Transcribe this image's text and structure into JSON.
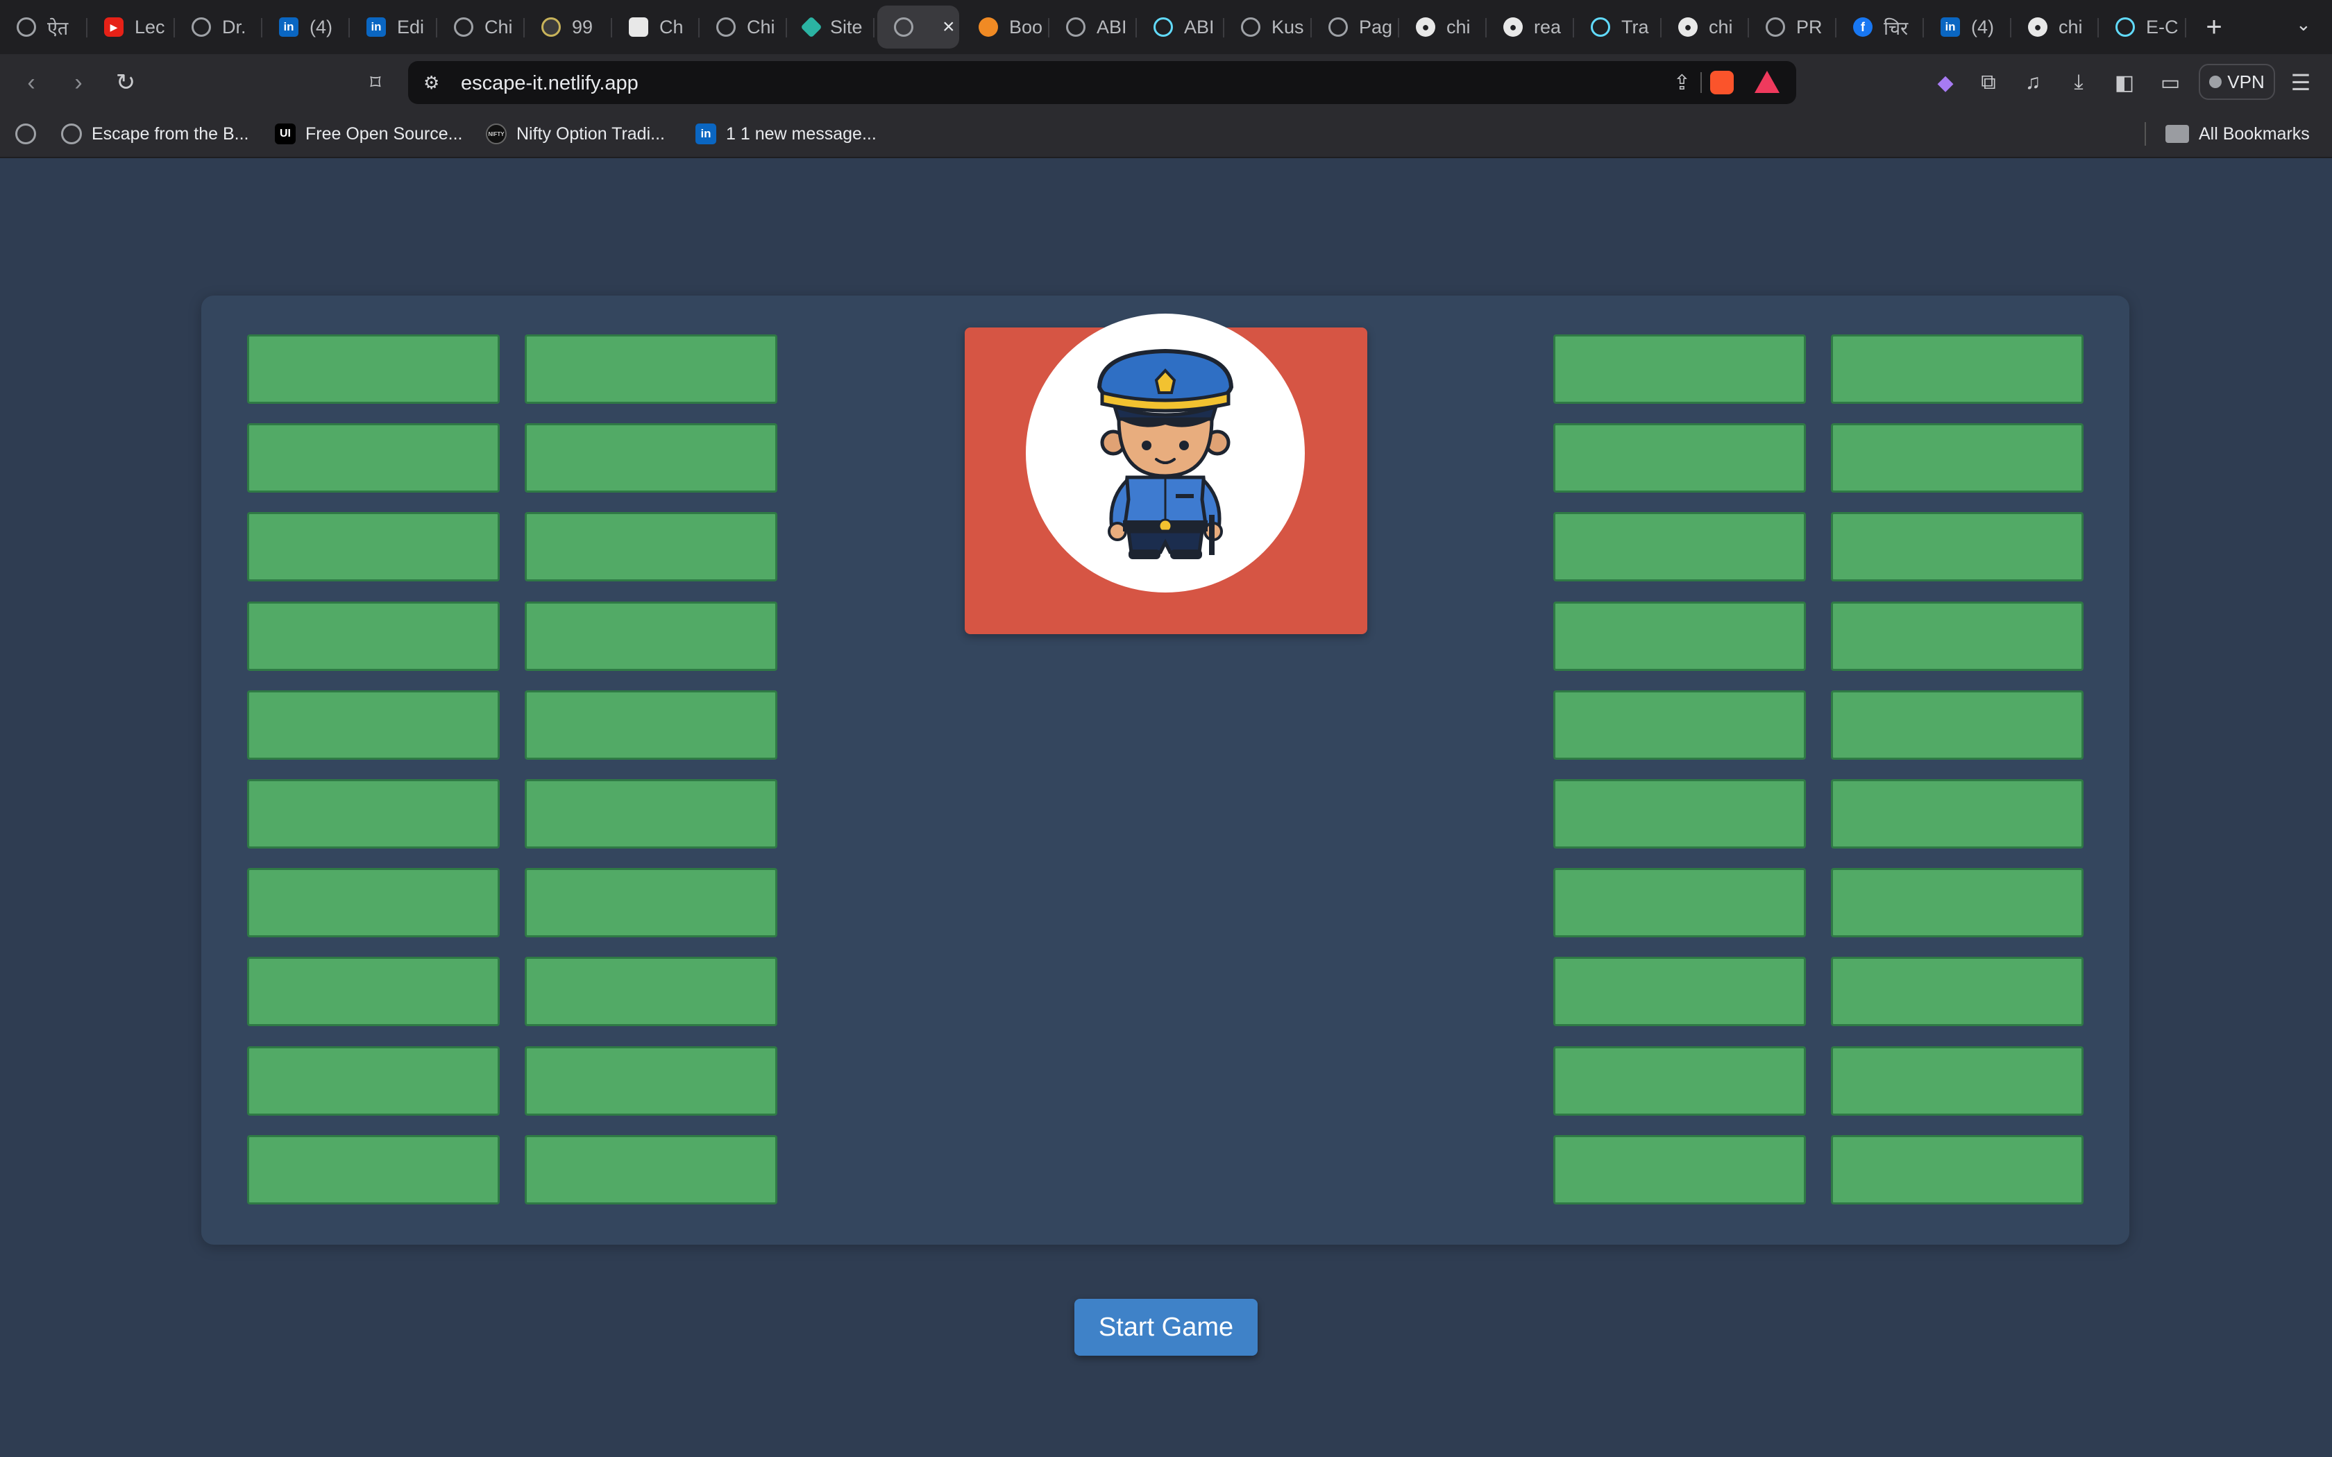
{
  "browser": {
    "tabs": [
      {
        "label": "ऐत",
        "icon": "globe-icon"
      },
      {
        "label": "Lec",
        "icon": "youtube-icon"
      },
      {
        "label": "Dr.",
        "icon": "globe-icon"
      },
      {
        "label": "(4)",
        "icon": "linkedin-icon"
      },
      {
        "label": "Edi",
        "icon": "linkedin-icon"
      },
      {
        "label": "Chi",
        "icon": "globe-icon"
      },
      {
        "label": "99",
        "icon": "ninety-nine-icon"
      },
      {
        "label": "Ch",
        "icon": "chatgpt-icon"
      },
      {
        "label": "Chi",
        "icon": "globe-icon"
      },
      {
        "label": "Site",
        "icon": "site-diamond-icon"
      },
      {
        "label": "",
        "icon": "globe-icon",
        "active": true
      },
      {
        "label": "Boo",
        "icon": "orange-circle-icon"
      },
      {
        "label": "ABI",
        "icon": "globe-icon"
      },
      {
        "label": "ABI",
        "icon": "react-icon"
      },
      {
        "label": "Kus",
        "icon": "globe-icon"
      },
      {
        "label": "Pag",
        "icon": "globe-icon"
      },
      {
        "label": "chi",
        "icon": "github-icon"
      },
      {
        "label": "rea",
        "icon": "github-icon"
      },
      {
        "label": "Tra",
        "icon": "react-icon"
      },
      {
        "label": "chi",
        "icon": "github-icon"
      },
      {
        "label": "PR",
        "icon": "globe-icon"
      },
      {
        "label": "चिर",
        "icon": "facebook-icon"
      },
      {
        "label": "(4)",
        "icon": "linkedin-icon"
      },
      {
        "label": "chi",
        "icon": "github-icon"
      },
      {
        "label": "E-C",
        "icon": "react-icon"
      }
    ],
    "new_tab_label": "+",
    "address": "escape-it.netlify.app",
    "vpn_label": "VPN",
    "bookmarks": [
      {
        "label": "",
        "icon": "globe-icon"
      },
      {
        "label": "Escape from the B...",
        "icon": "globe-icon"
      },
      {
        "label": "Free Open Source...",
        "icon": "ui-icon"
      },
      {
        "label": "Nifty Option Tradi...",
        "icon": "nifty-icon"
      },
      {
        "label": "1 1 new message...",
        "icon": "linkedin-icon"
      }
    ],
    "all_bookmarks_label": "All Bookmarks"
  },
  "game": {
    "card_color": "#d65544",
    "cell_color": "#52aa66",
    "board_color": "#34465e",
    "character": "police-officer-icon",
    "start_button_label": "Start Game",
    "rows": 10,
    "left_columns": 2,
    "right_columns": 2
  }
}
